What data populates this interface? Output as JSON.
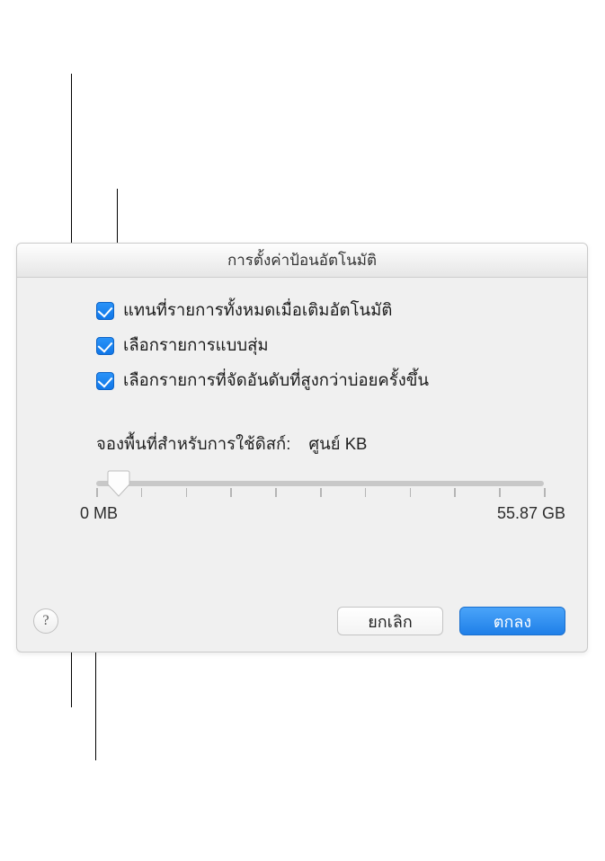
{
  "dialog": {
    "title": "การตั้งค่าป้อนอัตโนมัติ",
    "checkboxes": [
      {
        "label": "แทนที่รายการทั้งหมดเมื่อเติมอัตโนมัติ",
        "checked": true
      },
      {
        "label": "เลือกรายการแบบสุ่ม",
        "checked": true
      },
      {
        "label": "เลือกรายการที่จัดอันดับที่สูงกว่าบ่อยครั้งขึ้น",
        "checked": true
      }
    ],
    "slider": {
      "label": "จองพื้นที่สำหรับการใช้ดิสก์:",
      "value_text": "ศูนย์ KB",
      "min_label": "0 MB",
      "max_label": "55.87 GB",
      "position_pct": 5,
      "tick_count": 11
    },
    "buttons": {
      "cancel": "ยกเลิก",
      "ok": "ตกลง"
    },
    "help_icon": "?"
  }
}
